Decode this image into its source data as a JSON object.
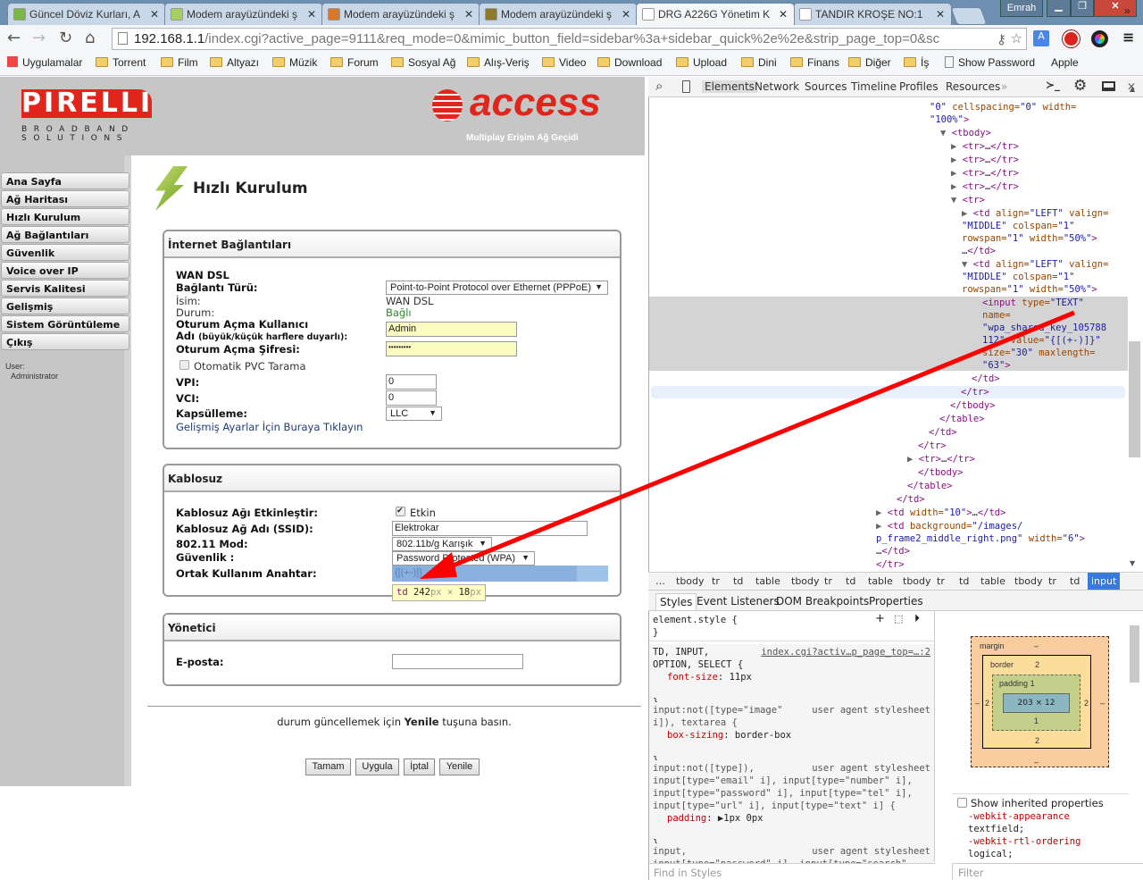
{
  "browser": {
    "tabs": [
      {
        "title": "Güncel Döviz Kurları, A",
        "icon_color": "#7ab648"
      },
      {
        "title": "Modem arayüzündeki ş",
        "icon_color": "#a8d060"
      },
      {
        "title": "Modem arayüzündeki ş",
        "icon_color": "#d9772a"
      },
      {
        "title": "Modem arayüzündeki ş",
        "icon_color": "#8a7a2a"
      },
      {
        "title": "DRG A226G Yönetim K",
        "icon_color": "#ffffff"
      },
      {
        "title": "TANDIR KROŞE NO:1",
        "icon_color": "#ffffff"
      }
    ],
    "active_tab": 4,
    "user": "Emrah",
    "url_host": "192.168.1.1",
    "url_rest": "/index.cgi?active_page=9111&req_mode=0&mimic_button_field=sidebar%3a+sidebar_quick%2e%2e&strip_page_top=0&sc",
    "bookmarks": [
      "Uygulamalar",
      "Torrent",
      "Film",
      "Altyazı",
      "Müzik",
      "Forum",
      "Sosyal Ağ",
      "Alış-Veriş",
      "Video",
      "Download",
      "Upload",
      "Dini",
      "Finans",
      "Diğer",
      "İş",
      "Show Password",
      "Apple"
    ],
    "bookmarks_more": "»"
  },
  "router": {
    "brand": "PIRELLI",
    "brand_sub1": "BROADBAND",
    "brand_sub2": "SOLUTIONS",
    "access_logo": "access",
    "access_tagline": "Multiplay Erişim Ağ Geçidi",
    "sidebar": [
      "Ana Sayfa",
      "Ağ Haritası",
      "Hızlı Kurulum",
      "Ağ Bağlantıları",
      "Güvenlik",
      "Voice over IP",
      "Servis Kalitesi",
      "Gelişmiş",
      "Sistem Görüntüleme",
      "Çıkış"
    ],
    "user_label": "User:",
    "user_name": "Administrator",
    "page_title": "Hızlı Kurulum",
    "internet": {
      "title": "İnternet Bağlantıları",
      "wan": "WAN DSL",
      "conn_type_label": "Bağlantı Türü:",
      "conn_type_value": "Point-to-Point Protocol over Ethernet (PPPoE)",
      "name_label": "İsim:",
      "name_value": "WAN DSL",
      "status_label": "Durum:",
      "status_value": "Bağlı",
      "status_color": "#2a8a2a",
      "user_label_1": "Oturum Açma Kullanıcı",
      "user_label_2": "Adı",
      "user_label_note": "(büyük/küçük harflere duyarlı):",
      "user_value": "Admin",
      "pass_label": "Oturum Açma Şifresi:",
      "pass_value": "•••••••••",
      "auto_pvc": "Otomatik PVC Tarama",
      "vpi_label": "VPI:",
      "vpi_value": "0",
      "vci_label": "VCI:",
      "vci_value": "0",
      "encap_label": "Kapsülleme:",
      "encap_value": "LLC",
      "advanced_link": "Gelişmiş Ayarlar İçin Buraya Tıklayın"
    },
    "wireless": {
      "title": "Kablosuz",
      "enable_label": "Kablosuz Ağı Etkinleştir:",
      "enable_value": "Etkin",
      "ssid_label": "Kablosuz Ağ Adı (SSID):",
      "ssid_value": "Elektrokar",
      "mode_label": "802.11 Mod:",
      "mode_value": "802.11b/g Karışık",
      "security_label": "Güvenlik :",
      "security_value": "Password Protected (WPA)",
      "key_label": "Ortak Kullanım Anahtar:",
      "key_value": "{[(+-)]}",
      "tooltip_tag": "td",
      "tooltip_w": "242",
      "tooltip_h": "18",
      "tooltip_unit": "px",
      "tooltip_x": "×"
    },
    "admin": {
      "title": "Yönetici",
      "email_label": "E-posta:",
      "email_value": ""
    },
    "footer_pre": "durum güncellemek için ",
    "footer_bold": "Yenile",
    "footer_post": " tuşuna basın.",
    "buttons": [
      "Tamam",
      "Uygula",
      "İptal",
      "Yenile"
    ]
  },
  "devtools": {
    "tabs": [
      "Elements",
      "Network",
      "Sources",
      "Timeline",
      "Profiles",
      "Resources"
    ],
    "more": "»",
    "code_lines": [
      [
        [
          "av",
          "\"0\""
        ],
        [
          "at",
          " cellspacing="
        ],
        [
          "av",
          "\"0\""
        ],
        [
          "at",
          " width="
        ]
      ],
      [
        [
          "av",
          "\"100%\""
        ],
        [
          "tg",
          ">"
        ]
      ],
      [
        [
          "ar2",
          "▼ "
        ],
        [
          "tg",
          "<tbody>"
        ]
      ],
      [
        [
          "ar2",
          "▶ "
        ],
        [
          "tg",
          "<tr>"
        ],
        [
          "tx",
          "…"
        ],
        [
          "tg",
          "</tr>"
        ]
      ],
      [
        [
          "ar2",
          "▶ "
        ],
        [
          "tg",
          "<tr>"
        ],
        [
          "tx",
          "…"
        ],
        [
          "tg",
          "</tr>"
        ]
      ],
      [
        [
          "ar2",
          "▶ "
        ],
        [
          "tg",
          "<tr>"
        ],
        [
          "tx",
          "…"
        ],
        [
          "tg",
          "</tr>"
        ]
      ],
      [
        [
          "ar2",
          "▶ "
        ],
        [
          "tg",
          "<tr>"
        ],
        [
          "tx",
          "…"
        ],
        [
          "tg",
          "</tr>"
        ]
      ],
      [
        [
          "ar2",
          "▼ "
        ],
        [
          "tg",
          "<tr>"
        ]
      ],
      [
        [
          "ar2",
          "▶ "
        ],
        [
          "tg",
          "<td"
        ],
        [
          "at",
          " align="
        ],
        [
          "av",
          "\"LEFT\""
        ],
        [
          "at",
          " valign="
        ]
      ],
      [
        [
          "av",
          "\"MIDDLE\""
        ],
        [
          "at",
          " colspan="
        ],
        [
          "av",
          "\"1\""
        ]
      ],
      [
        [
          "at",
          "rowspan="
        ],
        [
          "av",
          "\"1\""
        ],
        [
          "at",
          " width="
        ],
        [
          "av",
          "\"50%\""
        ],
        [
          "tg",
          ">"
        ]
      ],
      [
        [
          "tx",
          "…"
        ],
        [
          "tg",
          "</td>"
        ]
      ],
      [
        [
          "ar2",
          "▼ "
        ],
        [
          "tg",
          "<td"
        ],
        [
          "at",
          " align="
        ],
        [
          "av",
          "\"LEFT\""
        ],
        [
          "at",
          " valign="
        ]
      ],
      [
        [
          "av",
          "\"MIDDLE\""
        ],
        [
          "at",
          " colspan="
        ],
        [
          "av",
          "\"1\""
        ]
      ],
      [
        [
          "at",
          "rowspan="
        ],
        [
          "av",
          "\"1\""
        ],
        [
          "at",
          " width="
        ],
        [
          "av",
          "\"50%\""
        ],
        [
          "tg",
          ">"
        ]
      ],
      [
        [
          "tg",
          "<input"
        ],
        [
          "at",
          " type="
        ],
        [
          "av",
          "\"TEXT\""
        ]
      ],
      [
        [
          "at",
          "name="
        ]
      ],
      [
        [
          "av",
          "\"wpa_shared_key_105788"
        ]
      ],
      [
        [
          "av",
          "112\""
        ],
        [
          "at",
          " value="
        ],
        [
          "av",
          "\"{[(+-)]}\""
        ]
      ],
      [
        [
          "at",
          "size="
        ],
        [
          "av",
          "\"30\""
        ],
        [
          "at",
          " maxlength="
        ]
      ],
      [
        [
          "av",
          "\"63\""
        ],
        [
          "tg",
          ">"
        ]
      ],
      [
        [
          "tg",
          "</td>"
        ]
      ],
      [
        [
          "tg",
          "</tr>"
        ]
      ],
      [
        [
          "tg",
          "</tbody>"
        ]
      ],
      [
        [
          "tg",
          "</table>"
        ]
      ],
      [
        [
          "tg",
          "</td>"
        ]
      ],
      [
        [
          "tg",
          "</tr>"
        ]
      ],
      [
        [
          "ar2",
          "▶ "
        ],
        [
          "tg",
          "<tr>"
        ],
        [
          "tx",
          "…"
        ],
        [
          "tg",
          "</tr>"
        ]
      ],
      [
        [
          "tg",
          "</tbody>"
        ]
      ],
      [
        [
          "tg",
          "</table>"
        ]
      ],
      [
        [
          "tg",
          "</td>"
        ]
      ],
      [
        [
          "ar2",
          "▶ "
        ],
        [
          "tg",
          "<td"
        ],
        [
          "at",
          " width="
        ],
        [
          "av",
          "\"10\""
        ],
        [
          "tg",
          ">"
        ],
        [
          "tx",
          "…"
        ],
        [
          "tg",
          "</td>"
        ]
      ],
      [
        [
          "ar2",
          "▶ "
        ],
        [
          "tg",
          "<td"
        ],
        [
          "at",
          " background="
        ],
        [
          "av",
          "\"/images/"
        ]
      ],
      [
        [
          "av",
          "p_frame2_middle_right.png\""
        ],
        [
          "at",
          " width="
        ],
        [
          "av",
          "\"6\""
        ],
        [
          "tg",
          ">"
        ]
      ],
      [
        [
          "tx",
          "…"
        ],
        [
          "tg",
          "</td>"
        ]
      ],
      [
        [
          "tg",
          "</tr>"
        ]
      ]
    ],
    "breadcrumbs": [
      "…",
      "tbody",
      "tr",
      "td",
      "table",
      "tbody",
      "tr",
      "td",
      "table",
      "tbody",
      "tr",
      "td",
      "table",
      "tbody",
      "tr",
      "td",
      "input"
    ],
    "style_tabs": [
      "Styles",
      "Event Listeners",
      "DOM Breakpoints",
      "Properties"
    ],
    "rules": [
      {
        "selector": "element.style {",
        "source": "",
        "props": []
      },
      {
        "selector": "TD, INPUT,\nOPTION, SELECT {",
        "source": "index.cgi?activ…p_page_top=…:2",
        "props": [
          [
            "font-size",
            "11px"
          ]
        ]
      },
      {
        "selector": "input:not([type=\"image\"\ni]), textarea {",
        "source": "user agent stylesheet",
        "props": [
          [
            "box-sizing",
            "border-box"
          ]
        ]
      },
      {
        "selector": "input:not([type]),\ninput[type=\"email\" i], input[type=\"number\" i],\ninput[type=\"password\" i], input[type=\"tel\" i],\ninput[type=\"url\" i], input[type=\"text\" i] {",
        "source": "user agent stylesheet",
        "props": [
          [
            "padding",
            "▶1px 0px"
          ]
        ]
      },
      {
        "selector": "input,\ninput[type=\"password\" i], input[type=\"search\"",
        "source": "user agent stylesheet",
        "props": []
      }
    ],
    "find_placeholder": "Find in Styles",
    "box": {
      "margin": "margin",
      "margin_val": "–",
      "border": "border",
      "border_val": "2",
      "padding": "padding",
      "padding_val": "1",
      "content": "203 × 12",
      "side_border": "2",
      "side_margin": "–"
    },
    "show_inherited": "Show inherited properties",
    "computed": [
      [
        "-webkit-appearance",
        "textfield;"
      ],
      [
        "-webkit-rtl-ordering",
        "logical;"
      ]
    ],
    "filter_placeholder": "Filter"
  }
}
